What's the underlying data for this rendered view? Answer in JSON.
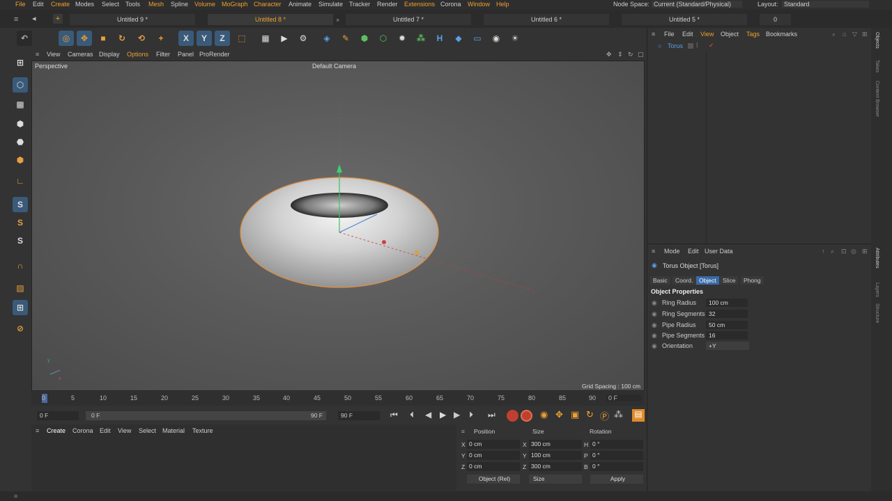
{
  "menubar": {
    "items": [
      "File",
      "Edit",
      "Create",
      "Modes",
      "Select",
      "Tools",
      "Mesh",
      "Spline",
      "Volume",
      "MoGraph",
      "Character",
      "Animate",
      "Simulate",
      "Tracker",
      "Render",
      "Extensions",
      "Corona",
      "Window",
      "Help"
    ],
    "node_space_label": "Node Space:",
    "node_space_value": "Current (Standard/Physical)",
    "layout_label": "Layout:",
    "layout_value": "Standard"
  },
  "tabs": [
    "Untitled 9 *",
    "Untitled 8 *",
    "Untitled 7 *",
    "Untitled 6 *",
    "Untitled 5 *"
  ],
  "tab_counter": "0",
  "viewport": {
    "menu": [
      "View",
      "Cameras",
      "Display",
      "Options",
      "Filter",
      "Panel",
      "ProRender"
    ],
    "title": "Perspective",
    "camera": "Default Camera",
    "grid_spacing": "Grid Spacing : 100 cm"
  },
  "timeline": {
    "ticks": [
      "0",
      "5",
      "10",
      "15",
      "20",
      "25",
      "30",
      "35",
      "40",
      "45",
      "50",
      "55",
      "60",
      "65",
      "70",
      "75",
      "80",
      "85",
      "90"
    ],
    "current_frame": "0 F",
    "start_frame": "0 F",
    "range_start": "0 F",
    "range_end": "90 F",
    "end_frame": "90 F"
  },
  "material_menu": [
    "Create",
    "Corona",
    "Edit",
    "View",
    "Select",
    "Material",
    "Texture"
  ],
  "coords": {
    "position_label": "Position",
    "size_label": "Size",
    "rotation_label": "Rotation",
    "rows": [
      {
        "axis": "X",
        "pos": "0 cm",
        "saxis": "X",
        "size": "300 cm",
        "raxis": "H",
        "rot": "0 °"
      },
      {
        "axis": "Y",
        "pos": "0 cm",
        "saxis": "Y",
        "size": "100 cm",
        "raxis": "P",
        "rot": "0 °"
      },
      {
        "axis": "Z",
        "pos": "0 cm",
        "saxis": "Z",
        "size": "300 cm",
        "raxis": "B",
        "rot": "0 °"
      }
    ],
    "mode_select": "Object (Rel)",
    "size_select": "Size",
    "apply": "Apply"
  },
  "object_manager": {
    "menu": [
      "File",
      "Edit",
      "View",
      "Object",
      "Tags",
      "Bookmarks"
    ],
    "objects": [
      "Torus"
    ]
  },
  "attributes": {
    "menu": [
      "Mode",
      "Edit",
      "User Data"
    ],
    "title": "Torus Object [Torus]",
    "tabs": [
      "Basic",
      "Coord.",
      "Object",
      "Slice",
      "Phong"
    ],
    "section": "Object Properties",
    "props": [
      {
        "label": "Ring Radius",
        "value": "100 cm"
      },
      {
        "label": "Ring Segments",
        "value": "32"
      },
      {
        "label": "Pipe Radius",
        "value": "50 cm"
      },
      {
        "label": "Pipe Segments",
        "value": "16"
      },
      {
        "label": "Orientation",
        "value": "+Y"
      }
    ]
  },
  "right_strip": [
    "Objects",
    "Takes",
    "Content Browser",
    "Attributes",
    "Layers",
    "Structure"
  ],
  "colors": {
    "accent": "#f0a030",
    "select_blue": "#3a6aa8"
  }
}
